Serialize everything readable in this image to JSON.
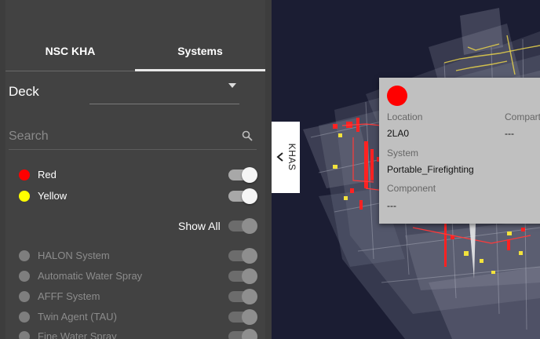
{
  "tabs": [
    {
      "label": "NSC KHA",
      "active": false
    },
    {
      "label": "Systems",
      "active": true
    }
  ],
  "deck": {
    "label": "Deck",
    "value": ""
  },
  "search": {
    "placeholder": "Search",
    "value": ""
  },
  "status_filters": [
    {
      "label": "Red",
      "color": "#ff0000",
      "on": true
    },
    {
      "label": "Yellow",
      "color": "#ffff00",
      "on": true
    }
  ],
  "show_all": {
    "label": "Show All",
    "on": false
  },
  "systems": [
    {
      "label": "HALON System",
      "on": false
    },
    {
      "label": "Automatic Water Spray",
      "on": false
    },
    {
      "label": "AFFF System",
      "on": false
    },
    {
      "label": "Twin Agent (TAU)",
      "on": false
    },
    {
      "label": "Fine Water Spray",
      "on": false
    }
  ],
  "handle": {
    "label": "KHAS"
  },
  "popup": {
    "status_color": "#ff0000",
    "location_label": "Location",
    "location_value": "2LA0",
    "compartment_label": "Compartment",
    "compartment_value": "---",
    "system_label": "System",
    "system_value": "Portable_Firefighting",
    "component_label": "Component",
    "component_value": "---"
  },
  "colors": {
    "panel_bg": "#424242",
    "viewport_bg": "#1b1d33",
    "accent_red": "#ff0000",
    "accent_yellow": "#ffff00"
  }
}
